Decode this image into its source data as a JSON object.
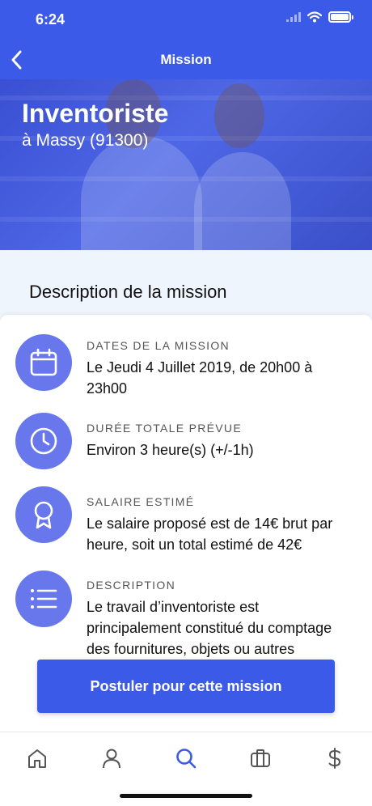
{
  "status_bar": {
    "time": "6:24"
  },
  "nav": {
    "title": "Mission"
  },
  "hero": {
    "title": "Inventoriste",
    "subtitle": "à Massy (91300)"
  },
  "section": {
    "title": "Description de la mission"
  },
  "items": [
    {
      "icon": "calendar-icon",
      "label": "DATES DE LA MISSION",
      "value": "Le Jeudi 4 Juillet 2019, de 20h00 à 23h00"
    },
    {
      "icon": "clock-icon",
      "label": "DURÉE TOTALE PRÉVUE",
      "value": "Environ 3 heure(s) (+/-1h)"
    },
    {
      "icon": "award-icon",
      "label": "SALAIRE ESTIMÉ",
      "value": "Le salaire proposé est de 14€ brut par heure, soit un total estimé de 42€"
    },
    {
      "icon": "list-icon",
      "label": "DESCRIPTION",
      "value": "Le travail d’inventoriste est principalement constitué du comptage des fournitures, objets ou autres"
    }
  ],
  "cta": {
    "label": "Postuler pour cette mission"
  },
  "tabbar": {
    "tabs": [
      "home-icon",
      "user-icon",
      "search-icon",
      "briefcase-icon",
      "dollar-icon"
    ],
    "active": 2
  },
  "colors": {
    "primary": "#3b5ae8",
    "icon_circle": "#6878ec",
    "section_bg": "#eef5fc",
    "tab_inactive": "#555555"
  }
}
